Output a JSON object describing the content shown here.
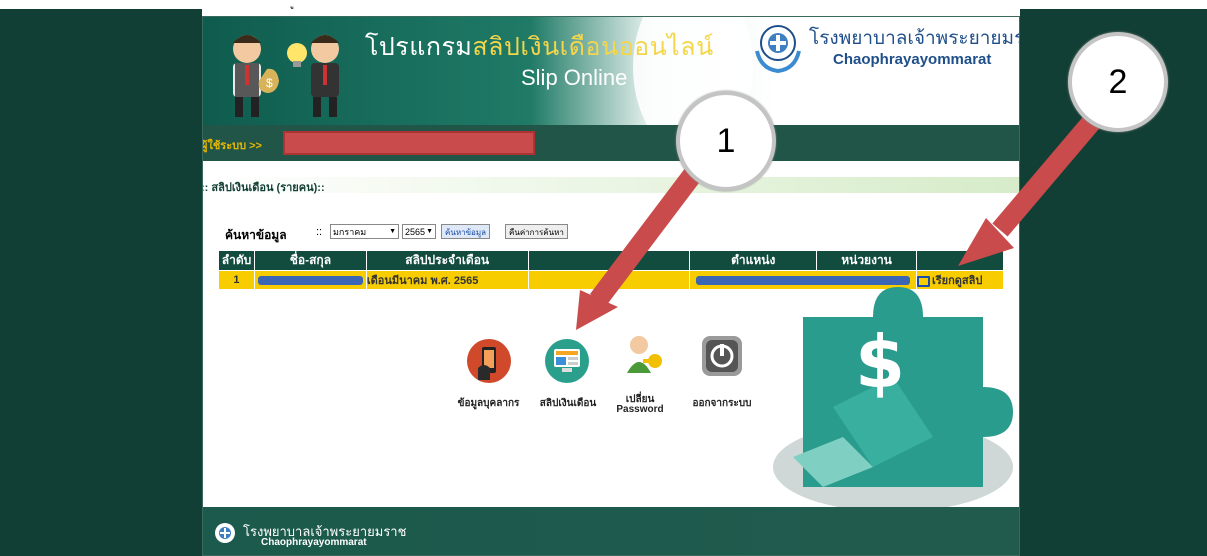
{
  "top_mark": "ู",
  "header": {
    "brand_prefix": "โปรแกรม",
    "brand_highlight": "สลิปเงินเดือนออนไลน์",
    "subtitle": "Slip Online",
    "hospital_thai": "โรงพยาบาลเจ้าพระยายมราช",
    "hospital_eng": "Chaophrayayommarat"
  },
  "userbar": {
    "label": "ผู้ใช้ระบบ >>"
  },
  "section": {
    "title": ":: สลิปเงินเดือน (รายคน)::"
  },
  "search": {
    "label": "ค้นหาข้อมูล",
    "sep": "::",
    "month": "มกราคม",
    "year": "2565",
    "search_button": "ค้นหาข้อมูล",
    "reset_button": "คืนค่าการค้นหา"
  },
  "table": {
    "headers": [
      "ลำดับ",
      "ชื่อ-สกุล",
      "สลิปประจำเดือน",
      "",
      "ตำแหน่ง",
      "หน่วยงาน",
      ""
    ],
    "rows": [
      {
        "no": "1",
        "slip_month": "เดือนมีนาคม พ.ศ. 2565",
        "action": "เรียกดูสลิป"
      }
    ]
  },
  "menu": {
    "personnel": "ข้อมูลบุคลากร",
    "salary_slip": "สลิปเงินเดือน",
    "change_pw_1": "เปลี่ยน",
    "change_pw_2": "Password",
    "logout": "ออกจากระบบ"
  },
  "footer": {
    "thai": "โรงพยาบาลเจ้าพระยายมราช",
    "eng": "Chaophrayayommarat"
  },
  "callouts": {
    "one": "1",
    "two": "2"
  },
  "colors": {
    "page_bg": "#123f35",
    "header_green": "#0f5c4e",
    "table_header": "#124c3e",
    "row_yellow": "#f8cd00",
    "redacted": "#c94b4b",
    "arrow": "#c94b4b"
  }
}
